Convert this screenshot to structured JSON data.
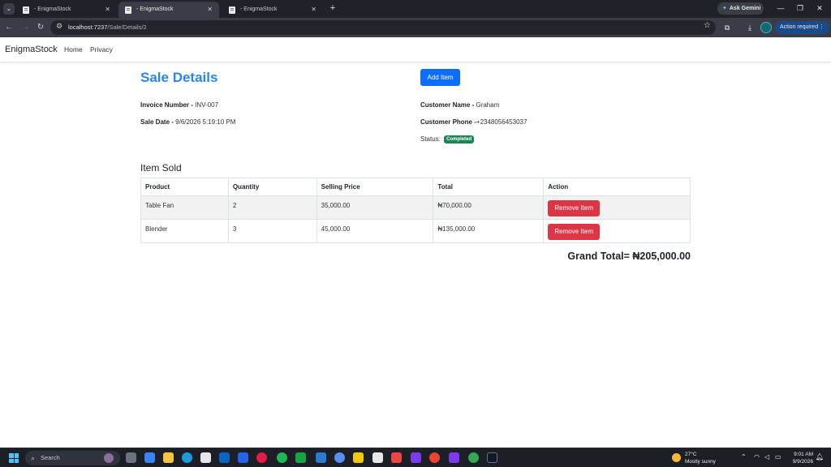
{
  "browser": {
    "tabs": [
      {
        "label": "- EnigmaStock",
        "active": false
      },
      {
        "label": "- EnigmaStock",
        "active": true
      },
      {
        "label": "- EnigmaStock",
        "active": false
      }
    ],
    "ask_gemini": "Ask Gemini",
    "url_host": "localhost:7237",
    "url_path": "/Sale/Details/2",
    "action_required": "Action required"
  },
  "app": {
    "brand": "EnigmaStock",
    "nav": [
      "Home",
      "Privacy"
    ]
  },
  "sale": {
    "title": "Sale Details",
    "add_item_label": "Add Item",
    "invoice_label": "Invoice Number - ",
    "invoice_value": "INV-007",
    "date_label": "Sale Date - ",
    "date_value": "9/6/2026 5:19:10 PM",
    "customer_name_label": "Customer Name - ",
    "customer_name_value": "Graham",
    "customer_phone_label": "Customer Phone -",
    "customer_phone_value": "+2348056453037",
    "status_label": "Status:",
    "status_value": "Completed",
    "status_color": "#198754"
  },
  "items": {
    "heading": "Item Sold",
    "columns": [
      "Product",
      "Quantity",
      "Selling Price",
      "Total",
      "Action"
    ],
    "rows": [
      {
        "product": "Table Fan",
        "quantity": "2",
        "price": "35,000.00",
        "total": "₦70,000.00",
        "action": "Remove Item"
      },
      {
        "product": "Blender",
        "quantity": "3",
        "price": "45,000.00",
        "total": "₦135,000.00",
        "action": "Remove Item"
      }
    ],
    "grand_total": "Grand Total= ₦205,000.00"
  },
  "taskbar": {
    "search_placeholder": "Search",
    "weather_temp": "27°C",
    "weather_desc": "Mostly sunny",
    "time": "9:01 AM",
    "date": "9/9/2026"
  },
  "colors": {
    "primary": "#0d6efd",
    "danger": "#dc3545",
    "title": "#2a86e8"
  }
}
